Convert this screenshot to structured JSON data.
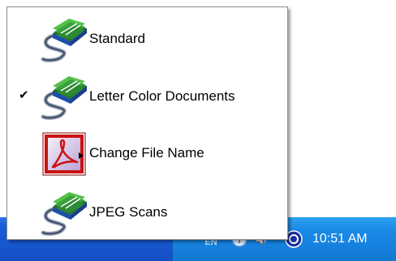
{
  "menu": {
    "items": [
      {
        "label": "Standard",
        "icon": "scanner-stack-icon",
        "checked": false
      },
      {
        "label": "Letter Color Documents",
        "icon": "scanner-stack-icon",
        "checked": true
      },
      {
        "label": "Change File Name",
        "icon": "pdf-acrobat-icon",
        "checked": false
      },
      {
        "label": "JPEG Scans",
        "icon": "scanner-stack-icon",
        "checked": false
      }
    ],
    "check_glyph": "✔"
  },
  "taskbar": {
    "language": "EN",
    "clock": "10:51 AM"
  },
  "colors": {
    "taskbar": "#1757d0",
    "tray": "#1580de",
    "acrobat_red": "#cc1111",
    "scanner_green": "#3aa23a"
  }
}
